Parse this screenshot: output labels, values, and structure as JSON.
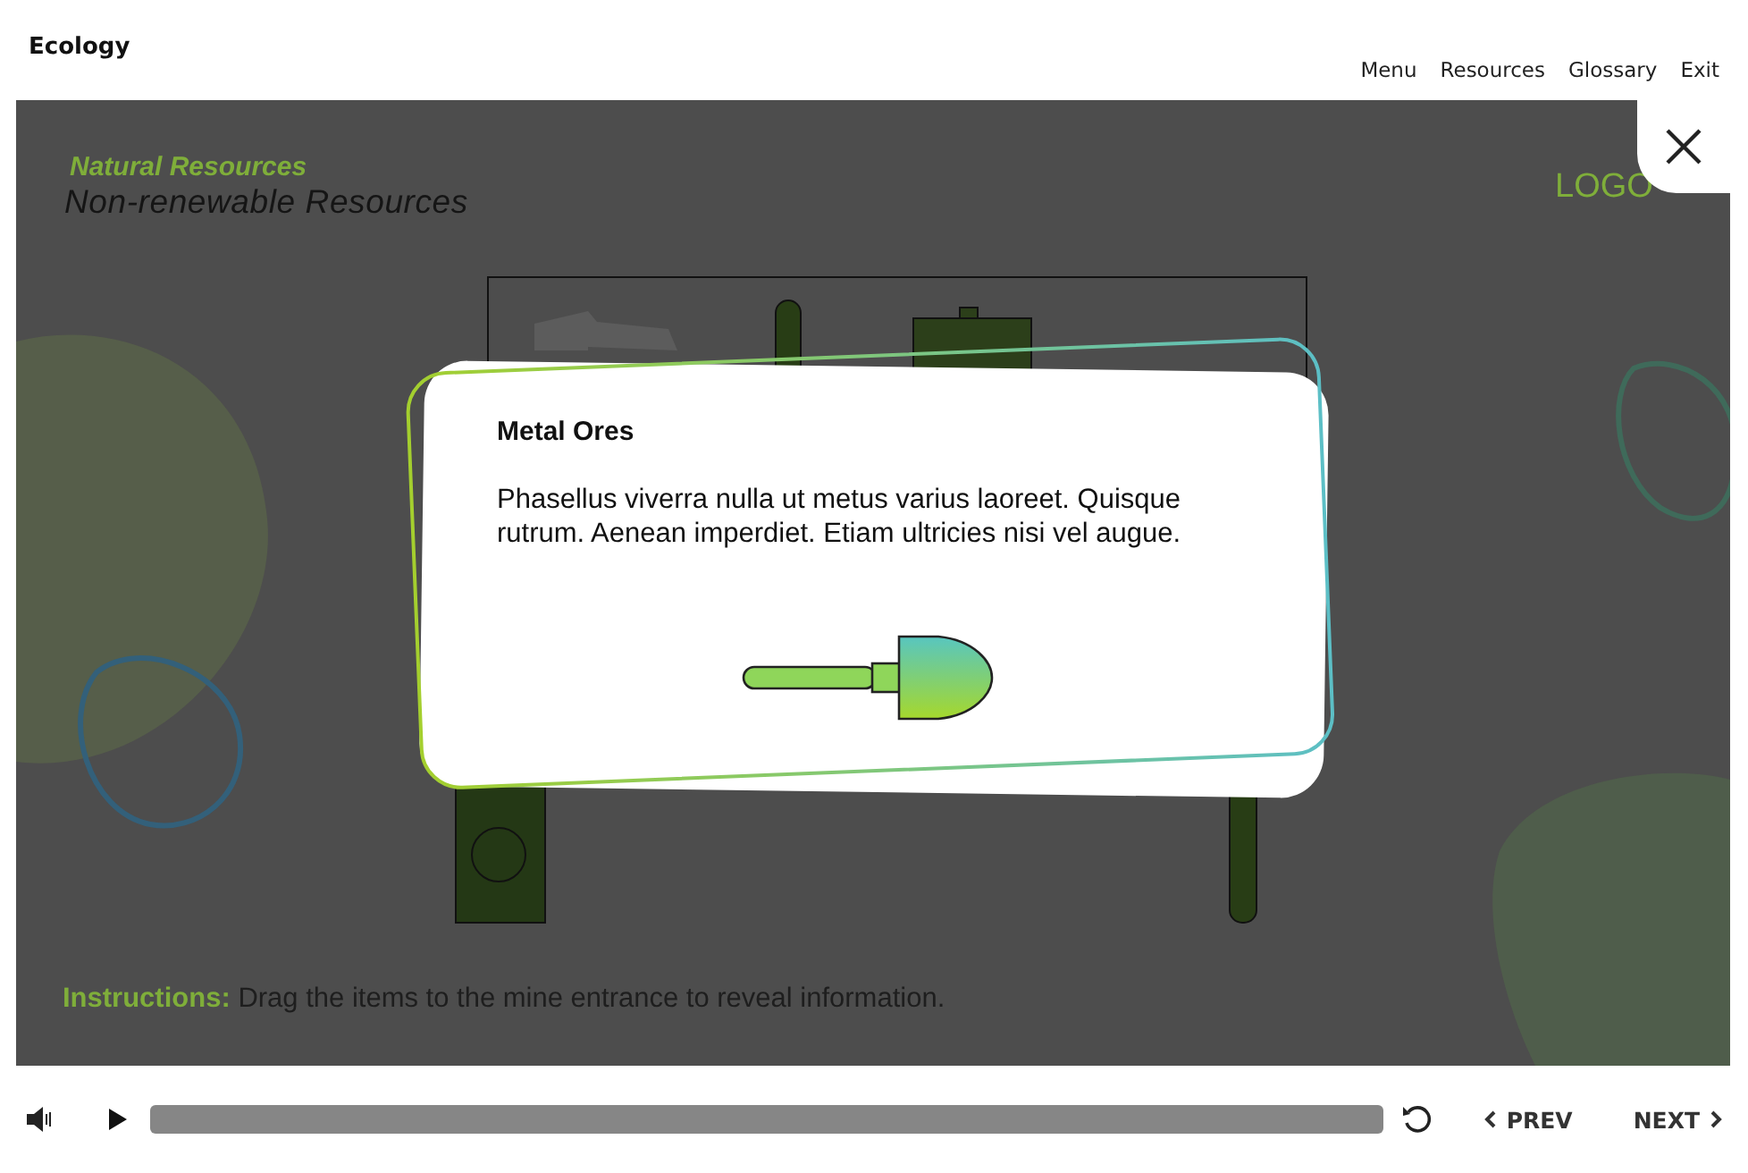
{
  "header": {
    "title": "Ecology",
    "nav": [
      "Menu",
      "Resources",
      "Glossary",
      "Exit"
    ]
  },
  "slide": {
    "subtitle": "Natural Resources",
    "title": "Non-renewable Resources",
    "logo": "LOGO",
    "instructions": {
      "label": "Instructions:",
      "text": "Drag the items to the mine entrance to reveal information."
    }
  },
  "popup": {
    "title": "Metal Ores",
    "body": "Phasellus viverra nulla ut metus varius laoreet. Quisque rutrum. Aenean imperdiet. Etiam ultricies nisi vel augue."
  },
  "footer": {
    "prev": "PREV",
    "next": "NEXT"
  }
}
